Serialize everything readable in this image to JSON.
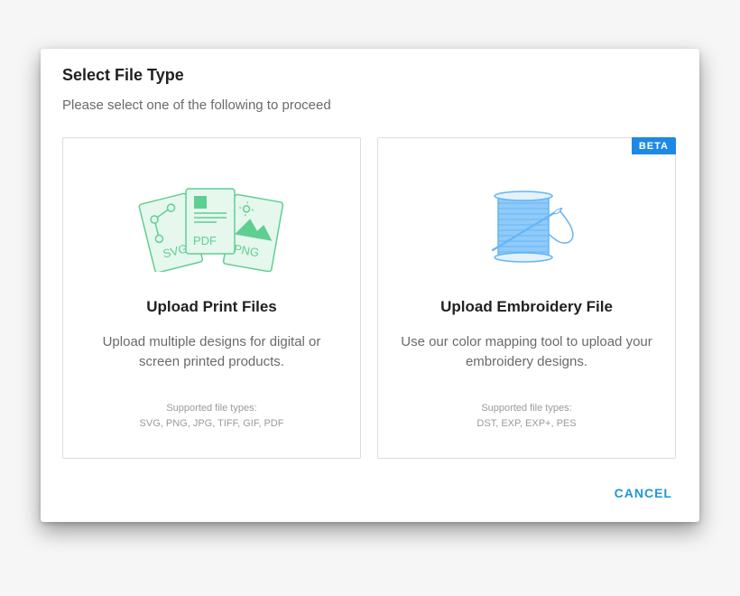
{
  "dialog": {
    "title": "Select File Type",
    "subtitle": "Please select one of the following to proceed",
    "cancel_label": "CANCEL"
  },
  "options": [
    {
      "title": "Upload Print Files",
      "description": "Upload multiple designs for digital or screen printed products.",
      "types_label": "Supported file types:",
      "types": "SVG, PNG, JPG, TIFF, GIF, PDF",
      "illustration": {
        "icon": "print-files-icon",
        "labels": [
          "SVG",
          "PDF",
          "PNG"
        ]
      }
    },
    {
      "title": "Upload Embroidery File",
      "description": "Use our color mapping tool to upload your embroidery designs.",
      "types_label": "Supported file types:",
      "types": "DST, EXP, EXP+, PES",
      "badge": "BETA",
      "illustration": {
        "icon": "thread-spool-icon"
      }
    }
  ],
  "colors": {
    "accent": "#2196d8",
    "badge": "#1e88e5",
    "print_icon": "#5fcf91",
    "thread_icon": "#64b5f6"
  }
}
